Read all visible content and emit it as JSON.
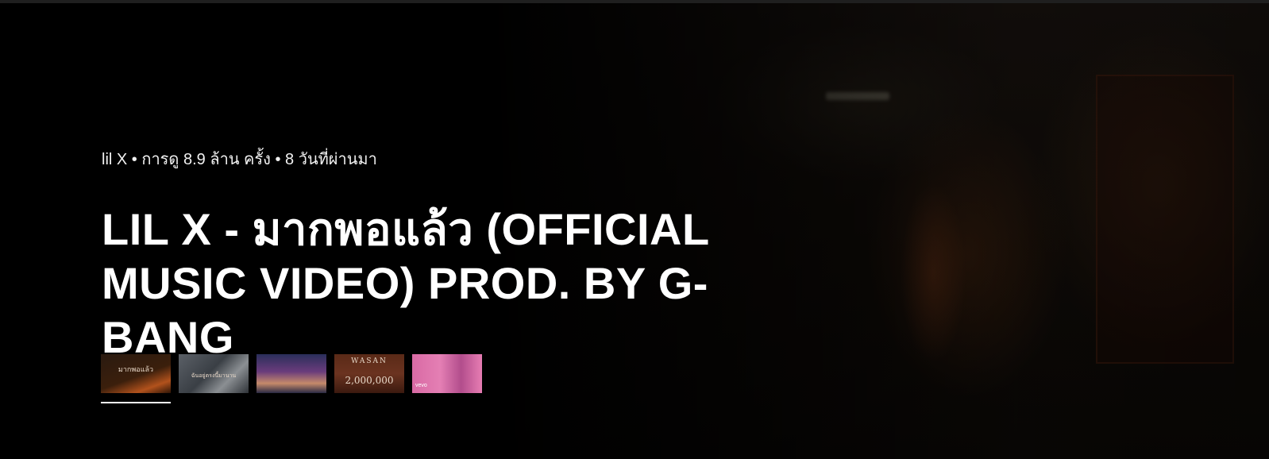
{
  "banner": {
    "meta": "lil X • การดู 8.9 ล้าน ครั้ง • 8 วันที่ผ่านมา",
    "title_line1": "LIL X - มากพอแล้ว (OFFICIAL",
    "title_line2": "MUSIC VIDEO) PROD. BY G-BANG"
  },
  "thumbnails": [
    {
      "caption": "มากพอแล้ว",
      "active": true
    },
    {
      "caption": "ฉันอยู่ตรงนี้มานาน",
      "active": false
    },
    {
      "caption": "",
      "active": false
    },
    {
      "caption": "WASAN",
      "caption2": "2,000,000",
      "active": false
    },
    {
      "caption": "vevo",
      "active": false
    }
  ],
  "colors": {
    "background": "#000000",
    "text": "#ffffff",
    "active_indicator": "#ffffff"
  }
}
